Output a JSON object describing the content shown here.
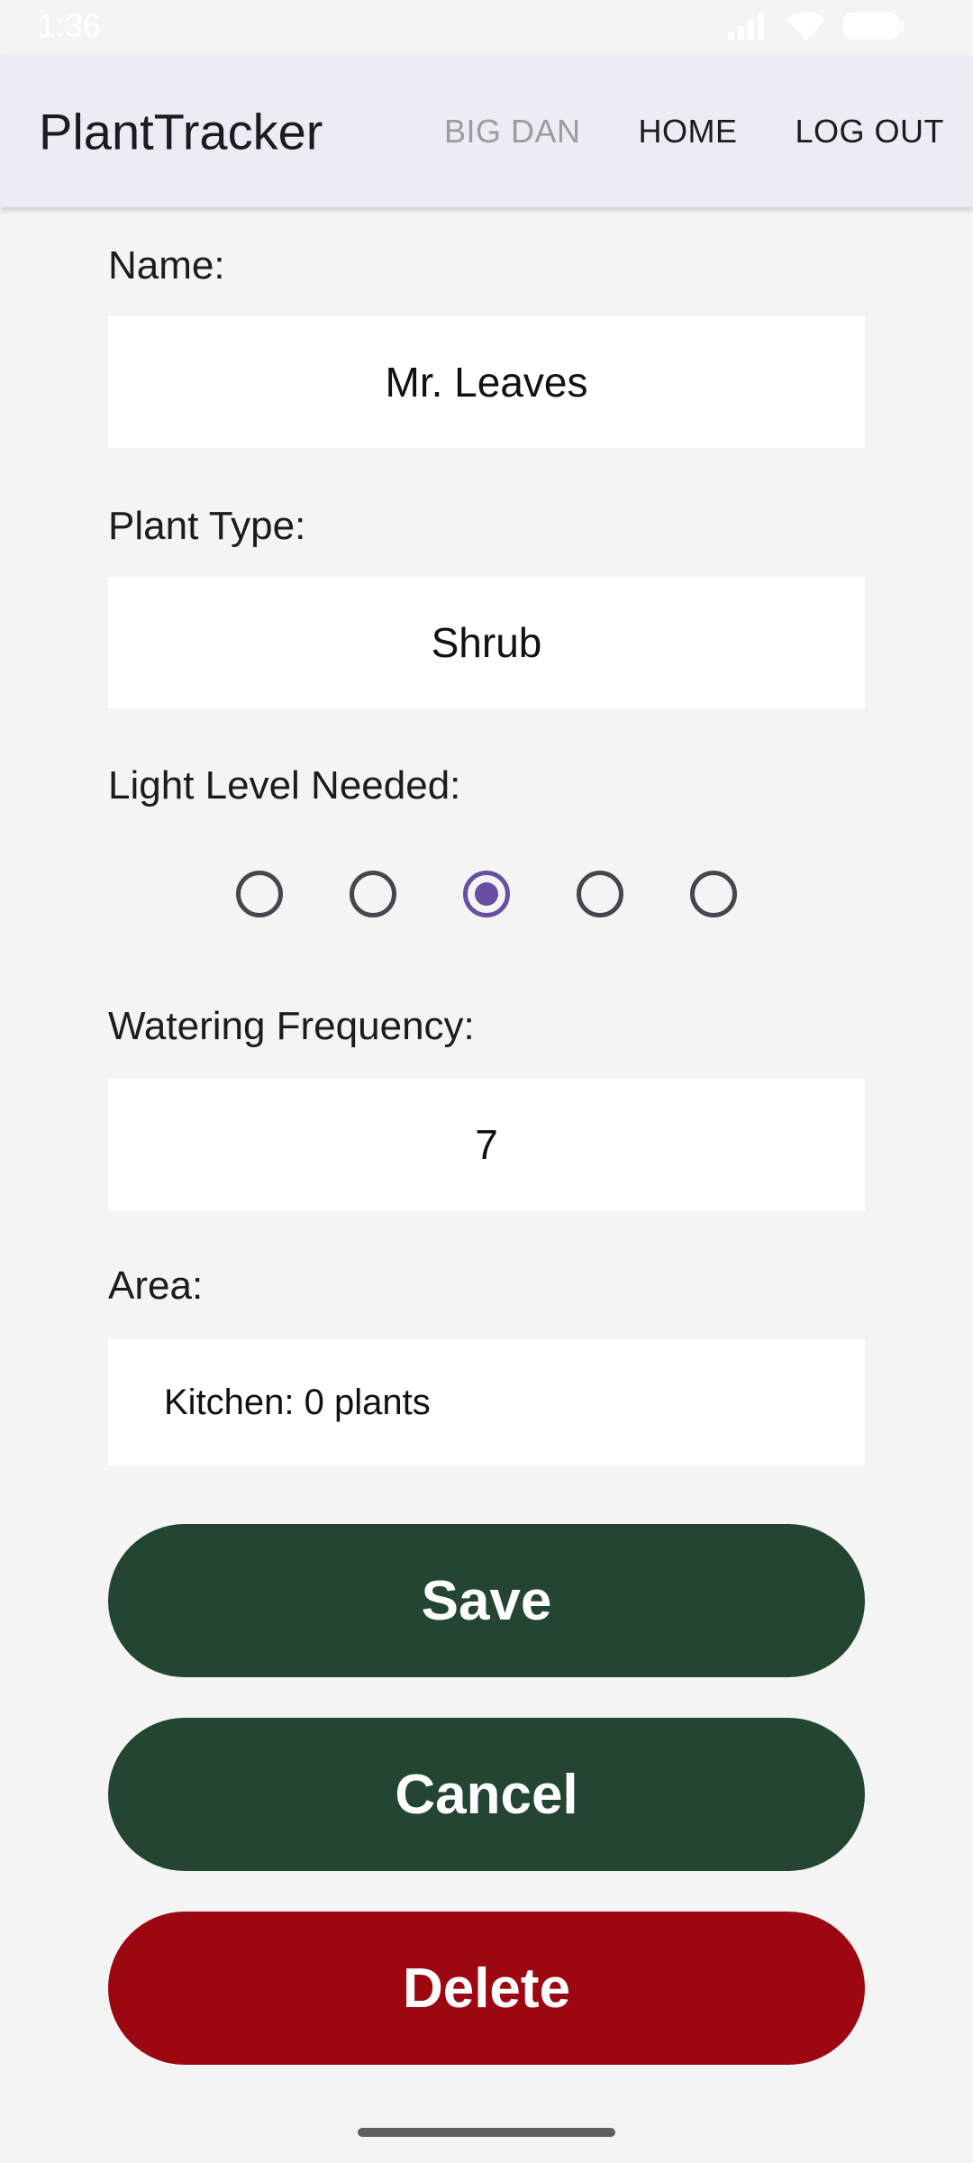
{
  "status_bar": {
    "time": "1:36",
    "icons": [
      "signal-icon",
      "wifi-icon",
      "battery-icon"
    ]
  },
  "app_bar": {
    "title": "PlantTracker",
    "nav": {
      "user": "BIG DAN",
      "home": "HOME",
      "logout": "LOG OUT"
    }
  },
  "form": {
    "name": {
      "label": "Name:",
      "value": "Mr. Leaves"
    },
    "plant_type": {
      "label": "Plant Type:",
      "value": "Shrub"
    },
    "light_level": {
      "label": "Light Level Needed:",
      "options": 5,
      "selected": 3
    },
    "watering": {
      "label": "Watering Frequency:",
      "value": "7"
    },
    "area": {
      "label": "Area:",
      "value": "Kitchen: 0 plants"
    }
  },
  "buttons": {
    "save": "Save",
    "cancel": "Cancel",
    "delete": "Delete"
  },
  "colors": {
    "app_bar_bg": "#f0eaf5",
    "primary_button": "#234532",
    "delete_button": "#9c0711",
    "radio_accent": "#6750a4",
    "background": "#f4f4f4"
  }
}
